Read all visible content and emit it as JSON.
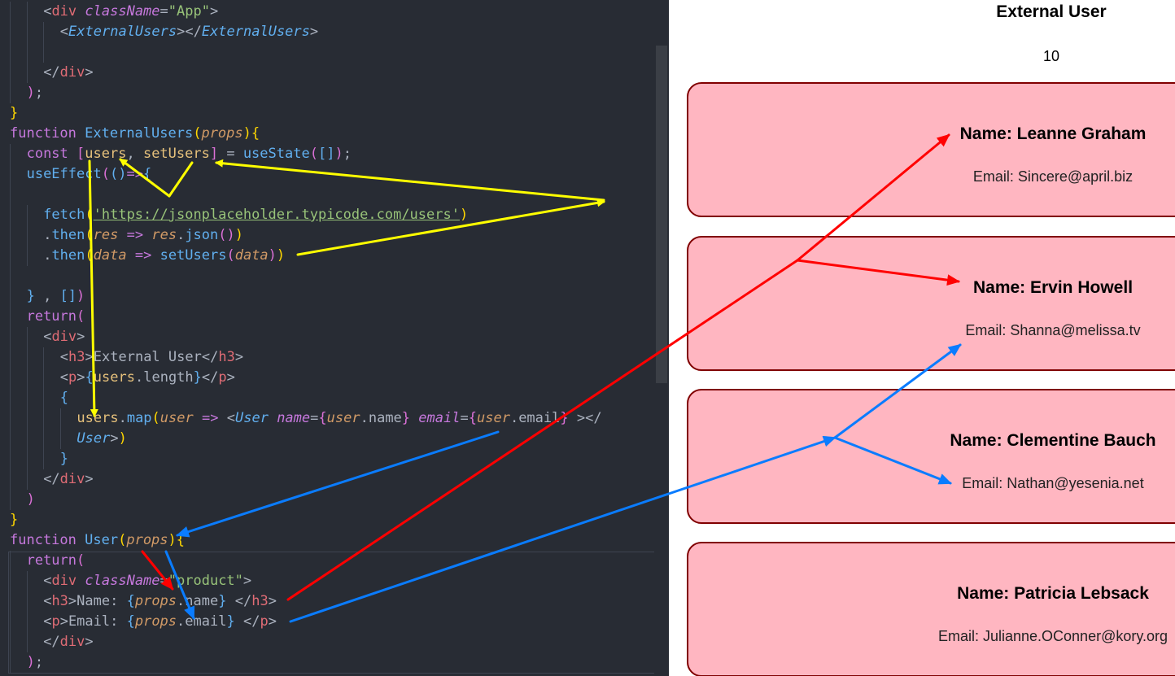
{
  "editor": {
    "lines": [
      {
        "indent": 2,
        "tokens": [
          [
            "t-punc",
            "<"
          ],
          [
            "t-tag",
            "div"
          ],
          [
            "t-plain",
            " "
          ],
          [
            "t-attr",
            "className"
          ],
          [
            "t-punc",
            "="
          ],
          [
            "t-str",
            "\"App\""
          ],
          [
            "t-punc",
            ">"
          ]
        ]
      },
      {
        "indent": 3,
        "tokens": [
          [
            "t-punc",
            "<"
          ],
          [
            "t-comp",
            "ExternalUsers"
          ],
          [
            "t-punc",
            "></"
          ],
          [
            "t-comp",
            "ExternalUsers"
          ],
          [
            "t-punc",
            ">"
          ]
        ]
      },
      {
        "indent": 3,
        "tokens": []
      },
      {
        "indent": 2,
        "tokens": [
          [
            "t-punc",
            "</"
          ],
          [
            "t-tag",
            "div"
          ],
          [
            "t-punc",
            ">"
          ]
        ]
      },
      {
        "indent": 1,
        "tokens": [
          [
            "t-brace3",
            ")"
          ],
          [
            "t-punc",
            ";"
          ]
        ]
      },
      {
        "indent": 0,
        "tokens": [
          [
            "t-brace2",
            "}"
          ]
        ]
      },
      {
        "indent": 0,
        "tokens": [
          [
            "t-kw",
            "function"
          ],
          [
            "t-plain",
            " "
          ],
          [
            "t-fn",
            "ExternalUsers"
          ],
          [
            "t-brace2",
            "("
          ],
          [
            "t-param",
            "props"
          ],
          [
            "t-brace2",
            "){"
          ]
        ]
      },
      {
        "indent": 1,
        "tokens": [
          [
            "t-kw",
            "const"
          ],
          [
            "t-plain",
            " "
          ],
          [
            "t-brace3",
            "["
          ],
          [
            "t-ident",
            "users"
          ],
          [
            "t-punc",
            ", "
          ],
          [
            "t-ident",
            "setUsers"
          ],
          [
            "t-brace3",
            "]"
          ],
          [
            "t-punc",
            " = "
          ],
          [
            "t-fn",
            "useState"
          ],
          [
            "t-brace3",
            "("
          ],
          [
            "t-brace",
            "[]"
          ],
          [
            "t-brace3",
            ")"
          ],
          [
            "t-punc",
            ";"
          ]
        ]
      },
      {
        "indent": 1,
        "tokens": [
          [
            "t-fn",
            "useEffect"
          ],
          [
            "t-brace3",
            "("
          ],
          [
            "t-brace",
            "()"
          ],
          [
            "t-kw",
            "=>"
          ],
          [
            "t-brace",
            "{"
          ]
        ]
      },
      {
        "indent": 1,
        "tokens": []
      },
      {
        "indent": 2,
        "tokens": [
          [
            "t-fn",
            "fetch"
          ],
          [
            "t-brace2",
            "("
          ],
          [
            "t-url",
            "'https://jsonplaceholder.typicode.com/users'"
          ],
          [
            "t-brace2",
            ")"
          ]
        ]
      },
      {
        "indent": 2,
        "tokens": [
          [
            "t-punc",
            "."
          ],
          [
            "t-meth",
            "then"
          ],
          [
            "t-brace2",
            "("
          ],
          [
            "t-param",
            "res"
          ],
          [
            "t-plain",
            " "
          ],
          [
            "t-kw",
            "=>"
          ],
          [
            "t-plain",
            " "
          ],
          [
            "t-param",
            "res"
          ],
          [
            "t-punc",
            "."
          ],
          [
            "t-meth",
            "json"
          ],
          [
            "t-brace3",
            "()"
          ],
          [
            "t-brace2",
            ")"
          ]
        ]
      },
      {
        "indent": 2,
        "tokens": [
          [
            "t-punc",
            "."
          ],
          [
            "t-meth",
            "then"
          ],
          [
            "t-brace2",
            "("
          ],
          [
            "t-param",
            "data"
          ],
          [
            "t-plain",
            " "
          ],
          [
            "t-kw",
            "=>"
          ],
          [
            "t-plain",
            " "
          ],
          [
            "t-fn",
            "setUsers"
          ],
          [
            "t-brace3",
            "("
          ],
          [
            "t-param",
            "data"
          ],
          [
            "t-brace3",
            ")"
          ],
          [
            "t-brace2",
            ")"
          ]
        ]
      },
      {
        "indent": 1,
        "tokens": []
      },
      {
        "indent": 1,
        "tokens": [
          [
            "t-brace",
            "}"
          ],
          [
            "t-punc",
            " , "
          ],
          [
            "t-brace",
            "[]"
          ],
          [
            "t-brace3",
            ")"
          ]
        ]
      },
      {
        "indent": 1,
        "tokens": [
          [
            "t-kw",
            "return"
          ],
          [
            "t-brace3",
            "("
          ]
        ]
      },
      {
        "indent": 2,
        "tokens": [
          [
            "t-punc",
            "<"
          ],
          [
            "t-tag",
            "div"
          ],
          [
            "t-punc",
            ">"
          ]
        ]
      },
      {
        "indent": 3,
        "tokens": [
          [
            "t-punc",
            "<"
          ],
          [
            "t-tag",
            "h3"
          ],
          [
            "t-punc",
            ">"
          ],
          [
            "t-plain",
            "External User"
          ],
          [
            "t-punc",
            "</"
          ],
          [
            "t-tag",
            "h3"
          ],
          [
            "t-punc",
            ">"
          ]
        ]
      },
      {
        "indent": 3,
        "tokens": [
          [
            "t-punc",
            "<"
          ],
          [
            "t-tag",
            "p"
          ],
          [
            "t-punc",
            ">"
          ],
          [
            "t-brace",
            "{"
          ],
          [
            "t-ident",
            "users"
          ],
          [
            "t-punc",
            "."
          ],
          [
            "t-plain",
            "length"
          ],
          [
            "t-brace",
            "}"
          ],
          [
            "t-punc",
            "</"
          ],
          [
            "t-tag",
            "p"
          ],
          [
            "t-punc",
            ">"
          ]
        ]
      },
      {
        "indent": 3,
        "tokens": [
          [
            "t-brace",
            "{"
          ]
        ]
      },
      {
        "indent": 4,
        "tokens": [
          [
            "t-ident",
            "users"
          ],
          [
            "t-punc",
            "."
          ],
          [
            "t-meth",
            "map"
          ],
          [
            "t-brace2",
            "("
          ],
          [
            "t-param",
            "user"
          ],
          [
            "t-plain",
            " "
          ],
          [
            "t-kw",
            "=>"
          ],
          [
            "t-plain",
            " "
          ],
          [
            "t-punc",
            "<"
          ],
          [
            "t-comp",
            "User"
          ],
          [
            "t-plain",
            " "
          ],
          [
            "t-attr",
            "name"
          ],
          [
            "t-punc",
            "="
          ],
          [
            "t-brace3",
            "{"
          ],
          [
            "t-param",
            "user"
          ],
          [
            "t-punc",
            "."
          ],
          [
            "t-plain",
            "name"
          ],
          [
            "t-brace3",
            "}"
          ],
          [
            "t-plain",
            " "
          ],
          [
            "t-attr",
            "email"
          ],
          [
            "t-punc",
            "="
          ],
          [
            "t-brace3",
            "{"
          ],
          [
            "t-param",
            "user"
          ],
          [
            "t-punc",
            "."
          ],
          [
            "t-plain",
            "email"
          ],
          [
            "t-brace3",
            "}"
          ],
          [
            "t-plain",
            " "
          ],
          [
            "t-punc",
            "></"
          ]
        ]
      },
      {
        "indent": 4,
        "tokens": [
          [
            "t-comp",
            "User"
          ],
          [
            "t-punc",
            ">"
          ],
          [
            "t-brace2",
            ")"
          ]
        ]
      },
      {
        "indent": 3,
        "tokens": [
          [
            "t-brace",
            "}"
          ]
        ]
      },
      {
        "indent": 2,
        "tokens": [
          [
            "t-punc",
            "</"
          ],
          [
            "t-tag",
            "div"
          ],
          [
            "t-punc",
            ">"
          ]
        ]
      },
      {
        "indent": 1,
        "tokens": [
          [
            "t-brace3",
            ")"
          ]
        ]
      },
      {
        "indent": 0,
        "tokens": [
          [
            "t-brace2",
            "}"
          ]
        ]
      },
      {
        "indent": 0,
        "tokens": [
          [
            "t-kw",
            "function"
          ],
          [
            "t-plain",
            " "
          ],
          [
            "t-fn",
            "User"
          ],
          [
            "t-brace2",
            "("
          ],
          [
            "t-param",
            "props"
          ],
          [
            "t-brace2",
            "){"
          ]
        ]
      },
      {
        "indent": 1,
        "tokens": [
          [
            "t-kw",
            "return"
          ],
          [
            "t-brace3",
            "("
          ]
        ]
      },
      {
        "indent": 2,
        "tokens": [
          [
            "t-punc",
            "<"
          ],
          [
            "t-tag",
            "div"
          ],
          [
            "t-plain",
            " "
          ],
          [
            "t-attr",
            "className"
          ],
          [
            "t-punc",
            "="
          ],
          [
            "t-str",
            "\"product\""
          ],
          [
            "t-punc",
            ">"
          ]
        ]
      },
      {
        "indent": 2,
        "tokens": [
          [
            "t-punc",
            "<"
          ],
          [
            "t-tag",
            "h3"
          ],
          [
            "t-punc",
            ">"
          ],
          [
            "t-plain",
            "Name: "
          ],
          [
            "t-brace",
            "{"
          ],
          [
            "t-param",
            "props"
          ],
          [
            "t-punc",
            "."
          ],
          [
            "t-plain",
            "name"
          ],
          [
            "t-brace",
            "}"
          ],
          [
            "t-plain",
            " "
          ],
          [
            "t-punc",
            "</"
          ],
          [
            "t-tag",
            "h3"
          ],
          [
            "t-punc",
            ">"
          ]
        ]
      },
      {
        "indent": 2,
        "tokens": [
          [
            "t-punc",
            "<"
          ],
          [
            "t-tag",
            "p"
          ],
          [
            "t-punc",
            ">"
          ],
          [
            "t-plain",
            "Email: "
          ],
          [
            "t-brace",
            "{"
          ],
          [
            "t-param",
            "props"
          ],
          [
            "t-punc",
            "."
          ],
          [
            "t-plain",
            "email"
          ],
          [
            "t-brace",
            "}"
          ],
          [
            "t-plain",
            " "
          ],
          [
            "t-punc",
            "</"
          ],
          [
            "t-tag",
            "p"
          ],
          [
            "t-punc",
            ">"
          ]
        ]
      },
      {
        "indent": 2,
        "tokens": [
          [
            "t-punc",
            "</"
          ],
          [
            "t-tag",
            "div"
          ],
          [
            "t-punc",
            ">"
          ]
        ]
      },
      {
        "indent": 1,
        "tokens": [
          [
            "t-brace3",
            ")"
          ],
          [
            "t-punc",
            ";"
          ]
        ]
      }
    ]
  },
  "preview": {
    "title": "External User",
    "count": "10",
    "users": [
      {
        "name": "Name: Leanne Graham",
        "email": "Email: Sincere@april.biz"
      },
      {
        "name": "Name: Ervin Howell",
        "email": "Email: Shanna@melissa.tv"
      },
      {
        "name": "Name: Clementine Bauch",
        "email": "Email: Nathan@yesenia.net"
      },
      {
        "name": "Name: Patricia Lebsack",
        "email": "Email: Julianne.OConner@kory.org"
      }
    ]
  },
  "annotation_colors": {
    "yellow": "#ffff00",
    "red": "#ff0000",
    "blue": "#0a7cff"
  }
}
